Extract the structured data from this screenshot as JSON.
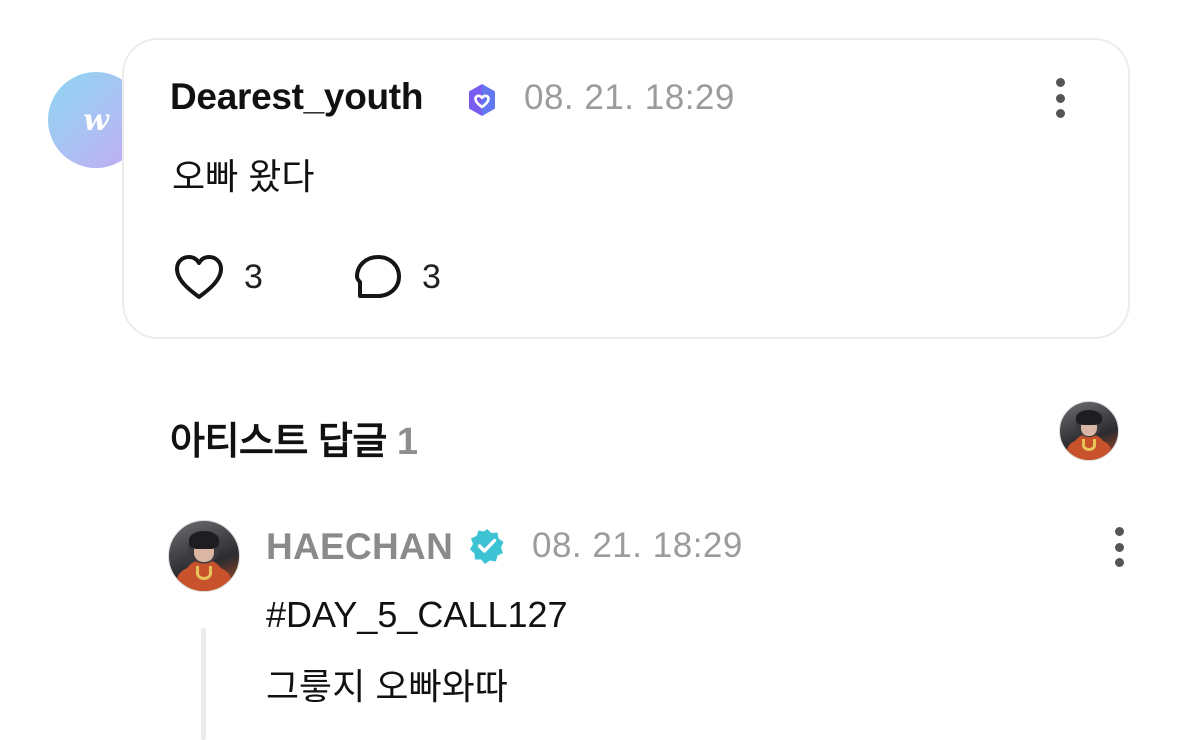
{
  "post": {
    "avatar_logo": "w",
    "username": "Dearest_youth",
    "verified_badge_color": "#7a5cf0",
    "timestamp": "08. 21. 18:29",
    "text": "오빠 왔다",
    "likes": "3",
    "comments": "3",
    "like_icon": "heart-outline-icon",
    "comment_icon": "speech-bubble-icon",
    "menu_icon": "more-vertical-icon"
  },
  "artist_replies": {
    "title": "아티스트 답글",
    "count": "1"
  },
  "reply": {
    "username": "HAECHAN",
    "verified_badge_color": "#3ec3d4",
    "timestamp": "08. 21. 18:29",
    "line1": "#DAY_5_CALL127",
    "line2": "그릏지 오빠와따",
    "menu_icon": "more-vertical-icon"
  }
}
